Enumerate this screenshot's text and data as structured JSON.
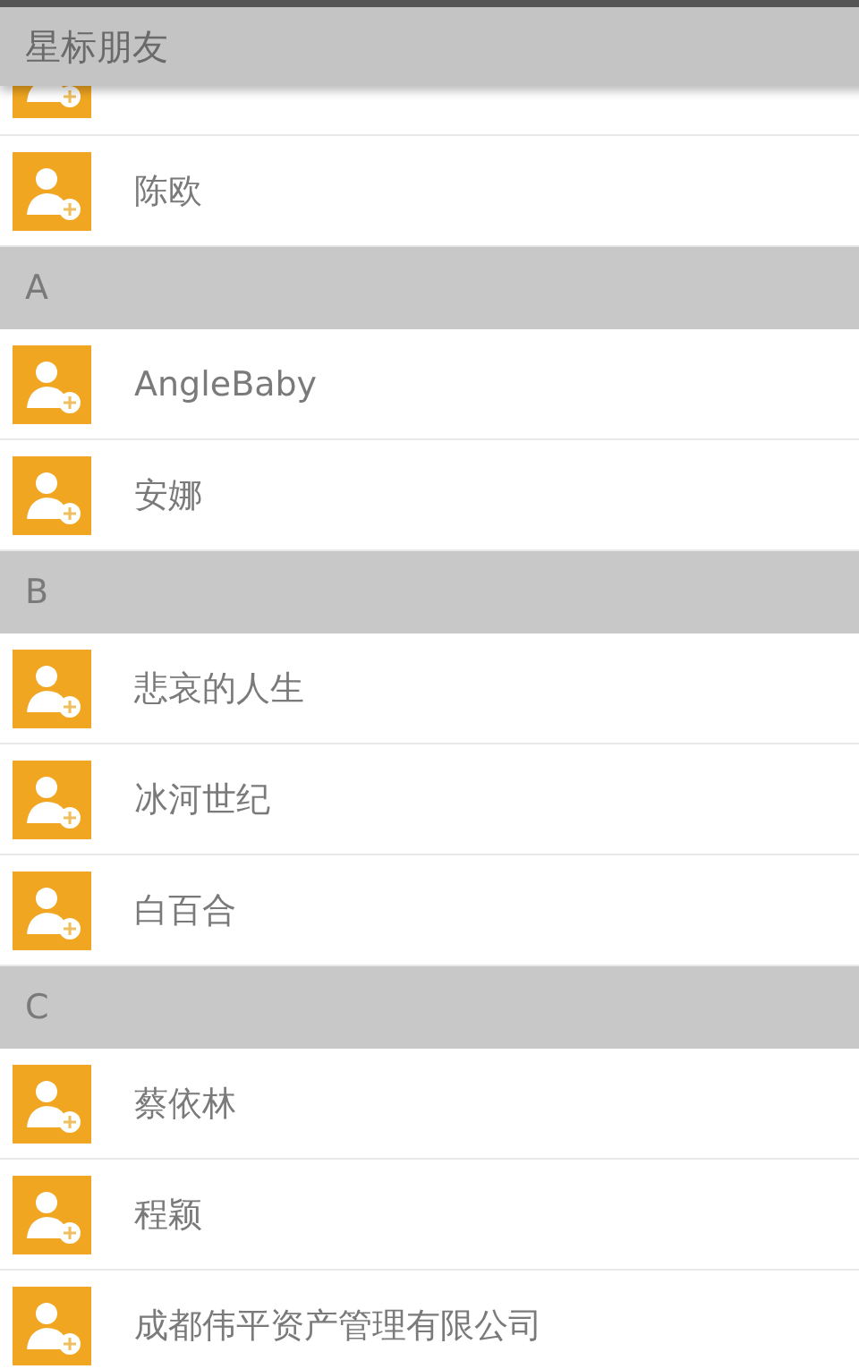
{
  "sticky_header": {
    "title": "星标朋友"
  },
  "rows": [
    {
      "kind": "contact_partial"
    },
    {
      "kind": "contact",
      "name": "陈欧"
    },
    {
      "kind": "section",
      "letter": "A"
    },
    {
      "kind": "contact",
      "name": "AngleBaby"
    },
    {
      "kind": "contact",
      "name": "安娜"
    },
    {
      "kind": "section",
      "letter": "B"
    },
    {
      "kind": "contact",
      "name": "悲哀的人生"
    },
    {
      "kind": "contact",
      "name": "冰河世纪"
    },
    {
      "kind": "contact",
      "name": "白百合"
    },
    {
      "kind": "section",
      "letter": "C"
    },
    {
      "kind": "contact",
      "name": "蔡依林"
    },
    {
      "kind": "contact",
      "name": "程颖"
    },
    {
      "kind": "contact",
      "name": "成都伟平资产管理有限公司"
    }
  ]
}
